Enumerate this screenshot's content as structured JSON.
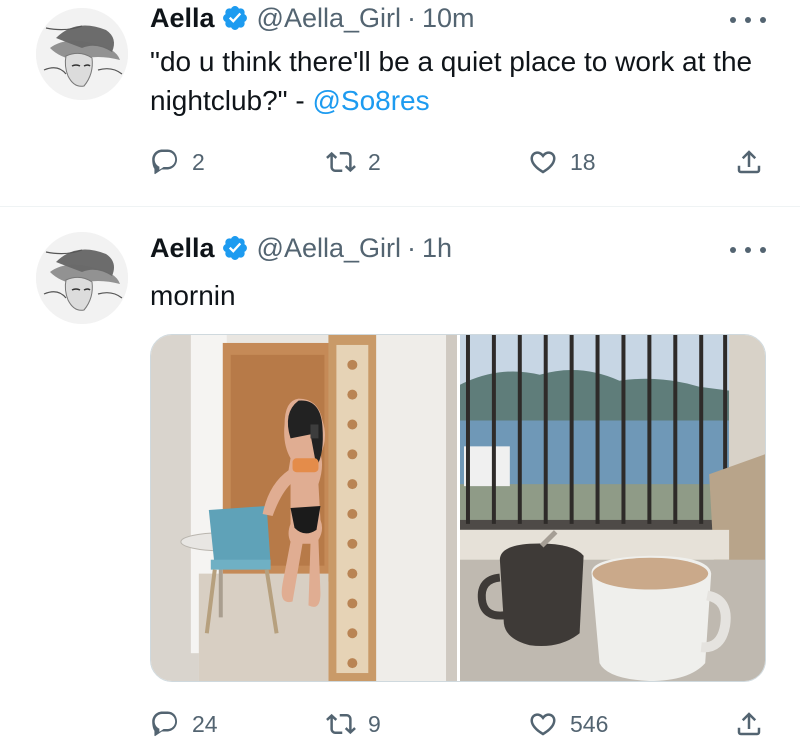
{
  "tweets": [
    {
      "author_name": "Aella",
      "handle": "@Aella_Girl",
      "separator": "·",
      "time": "10m",
      "text_main": "\"do u think there'll be a quiet place to work at the nightclub?\" -",
      "mention": "@So8res",
      "replies": "2",
      "retweets": "2",
      "likes": "18"
    },
    {
      "author_name": "Aella",
      "handle": "@Aella_Girl",
      "separator": "·",
      "time": "1h",
      "text_main": "mornin",
      "media": [
        {
          "icon": "mirror-selfie-photo"
        },
        {
          "icon": "coffee-balcony-photo"
        }
      ],
      "replies": "24",
      "retweets": "9",
      "likes": "546"
    }
  ],
  "icons": {
    "verified": "verified-badge-icon",
    "more": "more-icon",
    "reply": "reply-icon",
    "retweet": "retweet-icon",
    "like": "heart-icon",
    "share": "share-icon"
  },
  "colors": {
    "verified_blue": "#1d9bf0",
    "mention_blue": "#1d9bf0",
    "secondary_text": "#536471",
    "primary_text": "#0f1419",
    "divider": "#eff3f4"
  }
}
